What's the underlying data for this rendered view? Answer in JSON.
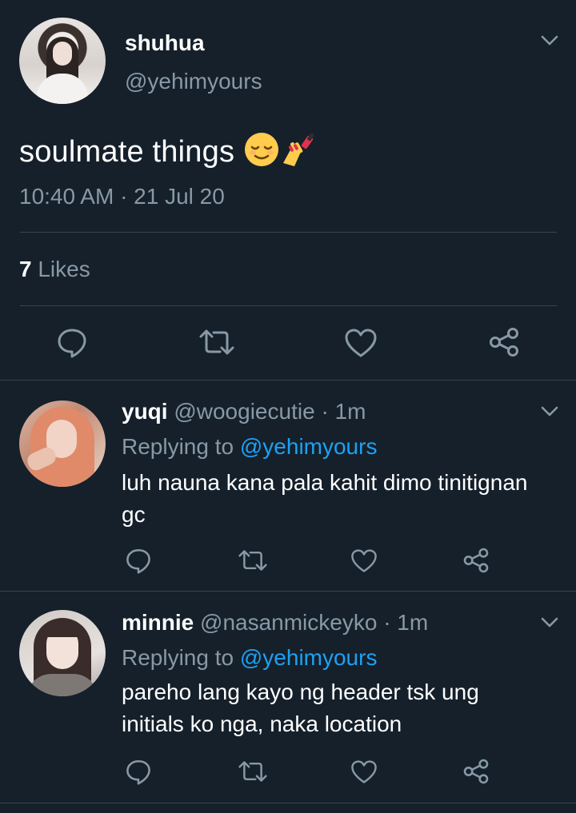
{
  "main_tweet": {
    "display_name": "shuhua",
    "handle": "@yehimyours",
    "text": "soulmate things",
    "emoji": [
      "relieved-face-emoji",
      "nail-polish-emoji"
    ],
    "timestamp": "10:40 AM · 21 Jul 20",
    "likes_count": "7",
    "likes_label": "Likes"
  },
  "replies": [
    {
      "display_name": "yuqi",
      "handle": "@woogiecutie",
      "time": "· 1m",
      "replying_prefix": "Replying to",
      "replying_to": "@yehimyours",
      "text_line1": "luh nauna kana pala kahit dimo tinitignan",
      "text_line2": "gc"
    },
    {
      "display_name": "minnie",
      "handle": "@nasanmickeyko",
      "time": "· 1m",
      "replying_prefix": "Replying to",
      "replying_to": "@yehimyours",
      "text_line1": "pareho lang kayo ng header tsk ung",
      "text_line2": "initials ko nga, naka location"
    }
  ],
  "colors": {
    "background": "#15202b",
    "muted_text": "#8899a6",
    "link": "#1da1f2",
    "divider": "#38444d"
  }
}
